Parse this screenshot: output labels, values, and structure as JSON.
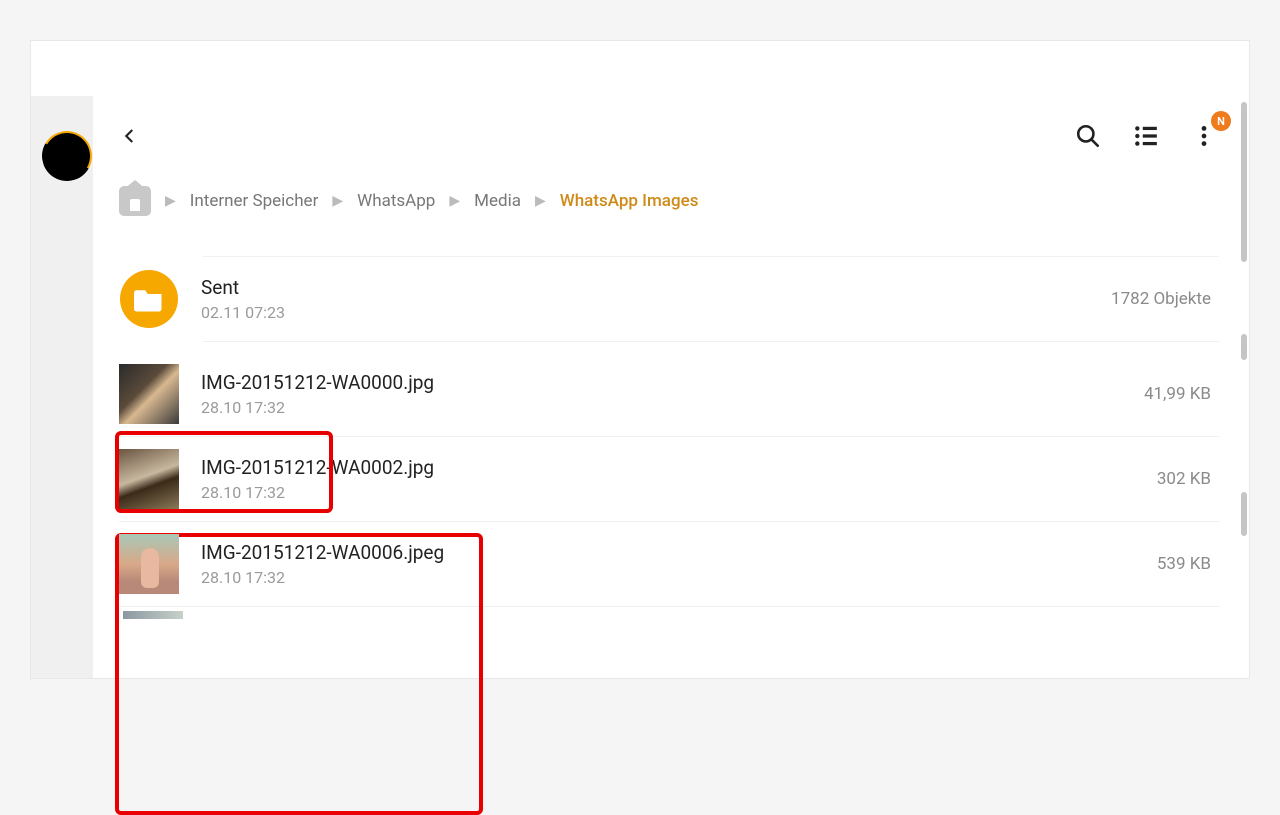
{
  "badge": "N",
  "breadcrumbs": {
    "items": [
      {
        "label": "Interner Speicher"
      },
      {
        "label": "WhatsApp"
      },
      {
        "label": "Media"
      },
      {
        "label": "WhatsApp Images"
      }
    ]
  },
  "folder": {
    "name": "Sent",
    "date": "02.11 07:23",
    "meta": "1782 Objekte"
  },
  "files": [
    {
      "name": "IMG-20151212-WA0000.jpg",
      "date": "28.10 17:32",
      "size": "41,99 KB"
    },
    {
      "name": "IMG-20151212-WA0002.jpg",
      "date": "28.10 17:32",
      "size": "302 KB"
    },
    {
      "name": "IMG-20151212-WA0006.jpeg",
      "date": "28.10 17:32",
      "size": "539 KB"
    }
  ]
}
